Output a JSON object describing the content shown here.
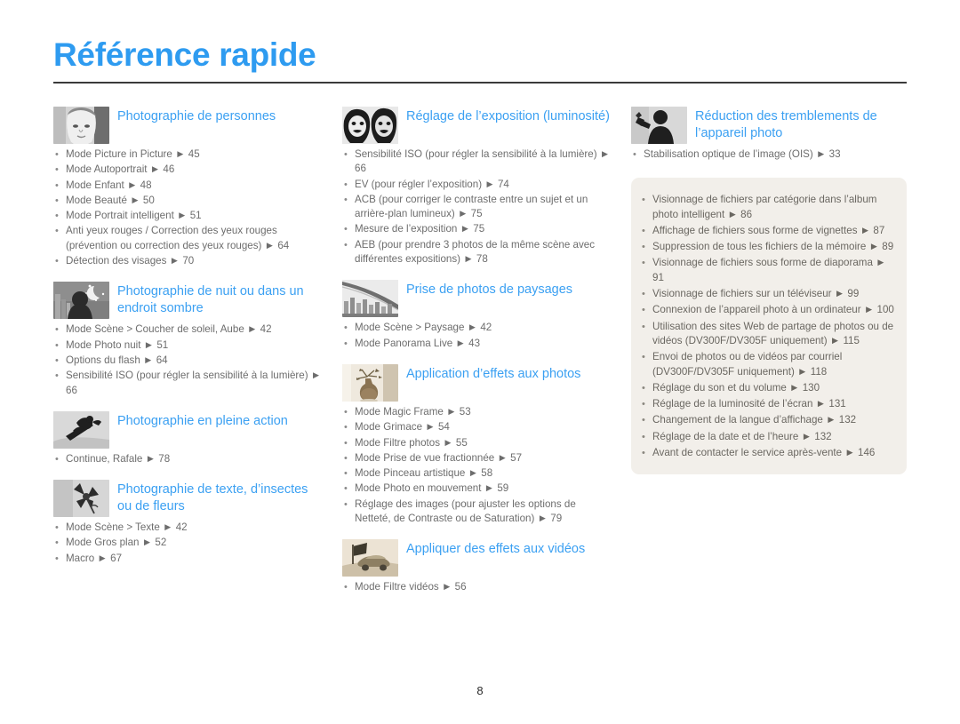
{
  "document": {
    "title": "Référence rapide",
    "page_number": "8",
    "accent_color": "#2e9bf0",
    "heading_color": "#3ba0f2",
    "body_text_color": "#6d6d6d",
    "info_box_color": "#f2efea"
  },
  "columns": [
    {
      "sections": [
        {
          "icon": "portrait-face-thumbnail",
          "title": "Photographie de personnes",
          "items": [
            "Mode Picture in Picture ► 45",
            "Mode Autoportrait ► 46",
            "Mode Enfant ► 48",
            "Mode Beauté ► 50",
            "Mode Portrait intelligent ► 51",
            "Anti yeux rouges / Correction des yeux rouges (prévention ou correction des yeux rouges) ► 64",
            "Détection des visages ► 70"
          ]
        },
        {
          "icon": "night-scene-thumbnail",
          "title": "Photographie de nuit ou dans un endroit sombre",
          "items": [
            "Mode Scène > Coucher de soleil, Aube ► 42",
            "Mode Photo nuit ► 51",
            "Options du flash ► 64",
            "Sensibilité ISO (pour régler la sensibilité à la lumière) ► 66"
          ]
        },
        {
          "icon": "snowboarder-action-thumbnail",
          "title": "Photographie en pleine action",
          "items": [
            "Continue, Rafale ► 78"
          ]
        },
        {
          "icon": "flower-macro-thumbnail",
          "title": "Photographie de texte, d’insectes ou de fleurs",
          "items": [
            "Mode Scène > Texte ► 42",
            "Mode Gros plan ► 52",
            "Macro ► 67"
          ]
        }
      ]
    },
    {
      "sections": [
        {
          "icon": "two-faces-exposure-thumbnail",
          "title": "Réglage de l’exposition (luminosité)",
          "items": [
            "Sensibilité ISO (pour régler la sensibilité à la lumière) ► 66",
            "EV (pour régler l’exposition) ► 74",
            "ACB (pour corriger le contraste entre un sujet et un arrière-plan lumineux) ► 75",
            "Mesure de l’exposition ► 75",
            "AEB (pour prendre 3 photos de la même scène avec différentes expositions) ► 78"
          ]
        },
        {
          "icon": "bridge-landscape-thumbnail",
          "title": "Prise de photos de paysages",
          "items": [
            "Mode Scène > Paysage ► 42",
            "Mode Panorama Live ► 43"
          ]
        },
        {
          "icon": "vase-effects-thumbnail",
          "title": "Application d’effets aux photos",
          "items": [
            "Mode Magic Frame ► 53",
            "Mode Grimace ► 54",
            "Mode Filtre photos ► 55",
            "Mode Prise de vue fractionnée ► 57",
            "Mode Pinceau artistique ► 58",
            "Mode Photo en mouvement ► 59",
            "Réglage des images (pour ajuster les options de Netteté, de Contraste ou de Saturation) ► 79"
          ]
        },
        {
          "icon": "car-video-effects-thumbnail",
          "title": "Appliquer des effets aux vidéos",
          "items": [
            "Mode Filtre vidéos ► 56"
          ]
        }
      ]
    },
    {
      "sections": [
        {
          "icon": "camera-shake-person-thumbnail",
          "title": "Réduction des tremblements de l’appareil photo",
          "items": [
            "Stabilisation optique de l’image (OIS) ► 33"
          ]
        }
      ],
      "info_box": {
        "items": [
          "Visionnage de fichiers par catégorie dans l’album photo intelligent ► 86",
          "Affichage de fichiers sous forme de vignettes ► 87",
          "Suppression de tous les fichiers de la mémoire ► 89",
          "Visionnage de fichiers sous forme de diaporama ► 91",
          "Visionnage de fichiers sur un téléviseur ► 99",
          "Connexion de l’appareil photo à un ordinateur ► 100",
          "Utilisation des sites Web de partage de photos ou de vidéos (DV300F/DV305F uniquement) ► 115",
          "Envoi de photos ou de vidéos par courriel (DV300F/DV305F uniquement) ► 118",
          "Réglage du son et du volume ► 130",
          "Réglage de la luminosité de l’écran ► 131",
          "Changement de la langue d’affichage ► 132",
          "Réglage de la date et de l’heure ► 132",
          "Avant de contacter le service après-vente ► 146"
        ]
      }
    }
  ]
}
